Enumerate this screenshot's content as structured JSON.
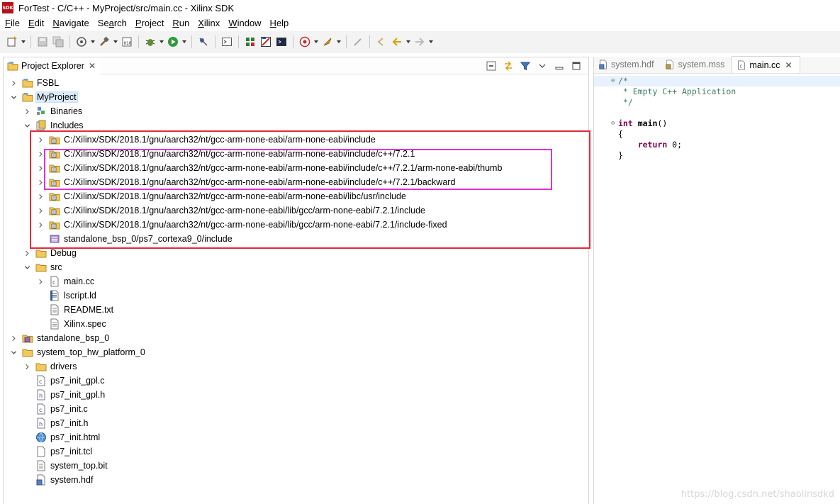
{
  "window": {
    "title": "ForTest - C/C++ - MyProject/src/main.cc - Xilinx SDK",
    "logo_text": "SDK"
  },
  "menu": {
    "items": [
      {
        "label": "File",
        "mnemonic": "F",
        "rest": "ile"
      },
      {
        "label": "Edit",
        "mnemonic": "E",
        "rest": "dit"
      },
      {
        "label": "Navigate",
        "mnemonic": "N",
        "rest": "avigate"
      },
      {
        "label": "Search",
        "mnemonic": "a",
        "prefix": "Se",
        "rest": "rch"
      },
      {
        "label": "Project",
        "mnemonic": "P",
        "rest": "roject"
      },
      {
        "label": "Run",
        "mnemonic": "R",
        "rest": "un"
      },
      {
        "label": "Xilinx",
        "mnemonic": "X",
        "rest": "ilinx"
      },
      {
        "label": "Window",
        "mnemonic": "W",
        "rest": "indow"
      },
      {
        "label": "Help",
        "mnemonic": "H",
        "rest": "elp"
      }
    ]
  },
  "explorer": {
    "tab_label": "Project Explorer",
    "tab_close": "✕",
    "tree": [
      {
        "label": "FSBL",
        "depth": 0,
        "twisty": "collapsed",
        "icon": "project-folder-icon"
      },
      {
        "label": "MyProject",
        "depth": 0,
        "twisty": "expanded",
        "icon": "project-folder-icon",
        "selected": true
      },
      {
        "label": "Binaries",
        "depth": 1,
        "twisty": "collapsed",
        "icon": "binaries-icon"
      },
      {
        "label": "Includes",
        "depth": 1,
        "twisty": "expanded",
        "icon": "includes-icon"
      },
      {
        "label": "C:/Xilinx/SDK/2018.1/gnu/aarch32/nt/gcc-arm-none-eabi/arm-none-eabi/include",
        "depth": 2,
        "twisty": "collapsed",
        "icon": "include-folder-icon"
      },
      {
        "label": "C:/Xilinx/SDK/2018.1/gnu/aarch32/nt/gcc-arm-none-eabi/arm-none-eabi/include/c++/7.2.1",
        "depth": 2,
        "twisty": "collapsed",
        "icon": "include-folder-icon"
      },
      {
        "label": "C:/Xilinx/SDK/2018.1/gnu/aarch32/nt/gcc-arm-none-eabi/arm-none-eabi/include/c++/7.2.1/arm-none-eabi/thumb",
        "depth": 2,
        "twisty": "collapsed",
        "icon": "include-folder-icon"
      },
      {
        "label": "C:/Xilinx/SDK/2018.1/gnu/aarch32/nt/gcc-arm-none-eabi/arm-none-eabi/include/c++/7.2.1/backward",
        "depth": 2,
        "twisty": "collapsed",
        "icon": "include-folder-icon"
      },
      {
        "label": "C:/Xilinx/SDK/2018.1/gnu/aarch32/nt/gcc-arm-none-eabi/arm-none-eabi/libc/usr/include",
        "depth": 2,
        "twisty": "collapsed",
        "icon": "include-folder-icon"
      },
      {
        "label": "C:/Xilinx/SDK/2018.1/gnu/aarch32/nt/gcc-arm-none-eabi/lib/gcc/arm-none-eabi/7.2.1/include",
        "depth": 2,
        "twisty": "collapsed",
        "icon": "include-folder-icon"
      },
      {
        "label": "C:/Xilinx/SDK/2018.1/gnu/aarch32/nt/gcc-arm-none-eabi/lib/gcc/arm-none-eabi/7.2.1/include-fixed",
        "depth": 2,
        "twisty": "collapsed",
        "icon": "include-folder-icon"
      },
      {
        "label": "standalone_bsp_0/ps7_cortexa9_0/include",
        "depth": 2,
        "twisty": "none",
        "icon": "bsp-include-icon"
      },
      {
        "label": "Debug",
        "depth": 1,
        "twisty": "collapsed",
        "icon": "folder-icon"
      },
      {
        "label": "src",
        "depth": 1,
        "twisty": "expanded",
        "icon": "folder-icon"
      },
      {
        "label": "main.cc",
        "depth": 2,
        "twisty": "collapsed",
        "icon": "cc-file-icon"
      },
      {
        "label": "lscript.ld",
        "depth": 2,
        "twisty": "none",
        "icon": "linker-script-icon"
      },
      {
        "label": "README.txt",
        "depth": 2,
        "twisty": "none",
        "icon": "text-file-icon"
      },
      {
        "label": "Xilinx.spec",
        "depth": 2,
        "twisty": "none",
        "icon": "text-file-icon"
      },
      {
        "label": "standalone_bsp_0",
        "depth": 0,
        "twisty": "collapsed",
        "icon": "bsp-project-icon"
      },
      {
        "label": "system_top_hw_platform_0",
        "depth": 0,
        "twisty": "expanded",
        "icon": "hw-platform-icon"
      },
      {
        "label": "drivers",
        "depth": 1,
        "twisty": "collapsed",
        "icon": "folder-icon"
      },
      {
        "label": "ps7_init_gpl.c",
        "depth": 1,
        "twisty": "none",
        "icon": "c-file-icon"
      },
      {
        "label": "ps7_init_gpl.h",
        "depth": 1,
        "twisty": "none",
        "icon": "h-file-icon"
      },
      {
        "label": "ps7_init.c",
        "depth": 1,
        "twisty": "none",
        "icon": "c-file-icon"
      },
      {
        "label": "ps7_init.h",
        "depth": 1,
        "twisty": "none",
        "icon": "h-file-icon"
      },
      {
        "label": "ps7_init.html",
        "depth": 1,
        "twisty": "none",
        "icon": "html-file-icon"
      },
      {
        "label": "ps7_init.tcl",
        "depth": 1,
        "twisty": "none",
        "icon": "blank-file-icon"
      },
      {
        "label": "system_top.bit",
        "depth": 1,
        "twisty": "none",
        "icon": "text-file-icon"
      },
      {
        "label": "system.hdf",
        "depth": 1,
        "twisty": "none",
        "icon": "hdf-file-icon"
      }
    ]
  },
  "editor": {
    "tabs": [
      {
        "label": "system.hdf",
        "active": false,
        "icon": "hdf-file-icon"
      },
      {
        "label": "system.mss",
        "active": false,
        "icon": "mss-file-icon"
      },
      {
        "label": "main.cc",
        "active": true,
        "icon": "cc-file-icon",
        "close": "✕"
      }
    ],
    "code_lines": [
      {
        "tokens": [
          {
            "t": "/*",
            "c": "comment"
          }
        ],
        "fold": "⊖",
        "current": true
      },
      {
        "tokens": [
          {
            "t": " * Empty C++ Application",
            "c": "comment"
          }
        ]
      },
      {
        "tokens": [
          {
            "t": " */",
            "c": "comment"
          }
        ]
      },
      {
        "tokens": []
      },
      {
        "tokens": [
          {
            "t": "int",
            "c": "keyword"
          },
          {
            "t": " ",
            "c": "plain"
          },
          {
            "t": "main",
            "c": "fn"
          },
          {
            "t": "()",
            "c": "plain"
          }
        ],
        "fold": "⊖"
      },
      {
        "tokens": [
          {
            "t": "{",
            "c": "plain"
          }
        ]
      },
      {
        "tokens": [
          {
            "t": "    ",
            "c": "plain"
          },
          {
            "t": "return",
            "c": "keyword"
          },
          {
            "t": " 0;",
            "c": "plain"
          }
        ]
      },
      {
        "tokens": [
          {
            "t": "}",
            "c": "plain"
          }
        ]
      }
    ]
  },
  "watermark": "https://blog.csdn.net/shaolinsdkd",
  "colors": {
    "highlight_red": "#e8283a",
    "highlight_magenta": "#e22fd7",
    "selection": "#dcebfc"
  }
}
